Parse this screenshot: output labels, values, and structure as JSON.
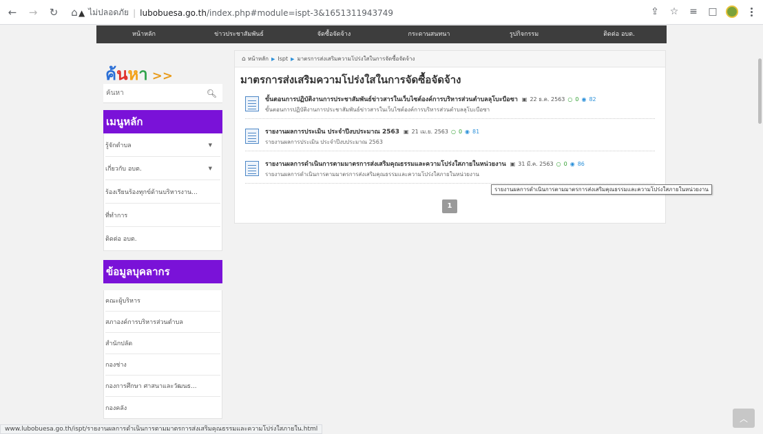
{
  "browser": {
    "security_icon": "warning-triangle-icon",
    "security_label": "ไม่ปลอดภัย",
    "url_host": "lubobuesa.go.th",
    "url_path": "/index.php#module=ispt-3&1651311943749"
  },
  "site_nav": [
    "หน้าหลัก",
    "ข่าวประชาสัมพันธ์",
    "จัดซื้อจัดจ้าง",
    "กระดานสนทนา",
    "รูปกิจกรรม",
    "ติดต่อ อบต."
  ],
  "sidebar": {
    "search_title": "ค้นหา",
    "search_arrow": ">>",
    "search_placeholder": "ค้นหา",
    "main_menu_title": "เมนูหลัก",
    "main_menu": [
      {
        "label": "รู้จักตำบล",
        "has_caret": true
      },
      {
        "label": "เกี่ยวกับ อบต.",
        "has_caret": true
      },
      {
        "label": "ร้องเรียนร้องทุกข์ด้านบริหารงาน...",
        "has_caret": false
      },
      {
        "label": "ที่ทำการ",
        "has_caret": false
      },
      {
        "label": "ติดต่อ อบต.",
        "has_caret": false
      }
    ],
    "staff_menu_title": "ข้อมูลบุคลากร",
    "staff_menu": [
      "คณะผู้บริหาร",
      "สภาองค์การบริหารส่วนตำบล",
      "สำนักปลัด",
      "กองช่าง",
      "กองการศึกษา ศาสนาและวัฒนธ...",
      "กองคลัง"
    ]
  },
  "content": {
    "breadcrumb": [
      "หน้าหลัก",
      "Ispt",
      "มาตรการส่งเสริมความโปร่งใสในการจัดซื้อจัดจ้าง"
    ],
    "title": "มาตรการส่งเสริมความโปร่งใสในการจัดซื้อจัดจ้าง",
    "posts": [
      {
        "title": "ขั้นตอนการปฏิบัติงานการประชาสัมพันธ์ข่าวสารในเว็บไซต์องค์การบริหารส่วนตำบลลุโบะบือซา",
        "date": "22 ธ.ค. 2563",
        "comments": "0",
        "views": "82",
        "description": "ขั้นตอนการปฏิบัติงานการประชาสัมพันธ์ข่าวสารในเว็บไซต์องค์การบริหารส่วนตำบลลุโบะบือซา"
      },
      {
        "title": "รายงานผลการประเมิน ประจำปีงบประมาณ 2563",
        "date": "21 เม.ย. 2563",
        "comments": "0",
        "views": "81",
        "description": "รายงานผลการประเมิน ประจำปีงบประมาณ 2563"
      },
      {
        "title": "รายงานผลการดำเนินการตามมาตรการส่งเสริมคุณธรรมและความโปร่งใสภายในหน่วยงาน",
        "date": "31 มี.ค. 2563",
        "comments": "0",
        "views": "86",
        "description": "รายงานผลการดำเนินการตามมาตรการส่งเสริมคุณธรรมและความโปร่งใสภายในหน่วยงาน"
      }
    ],
    "page_number": "1"
  },
  "tooltip": "รายงานผลการดำเนินการตามมาตรการส่งเสริมคุณธรรมและความโปร่งใสภายในหน่วยงาน",
  "status_url": "www.lubobuesa.go.th/ispt/รายงานผลการดำเนินการตามมาตรการส่งเสริมคุณธรรมและความโปร่งใสภายใน.html",
  "colors": {
    "menu_header": "#7a12d8",
    "nav_bar": "#3d3d3d",
    "search_title_letters": [
      "#2b6fd6",
      "#e0312b",
      "#f3a21b",
      "#2fa34a"
    ],
    "search_arrow": "#e89b1c",
    "views": "#2b90d9",
    "comments": "#2e9e2e"
  }
}
